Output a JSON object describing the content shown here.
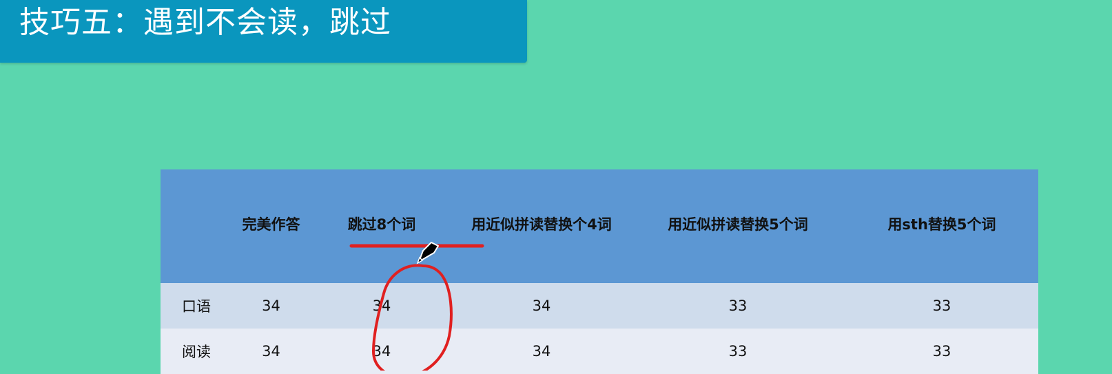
{
  "slide": {
    "title": "技巧五：遇到不会读，跳过"
  },
  "table": {
    "headers": [
      "",
      "完美作答",
      "跳过8个词",
      "用近似拼读替换个4词",
      "用近似拼读替换5个词",
      "用sth替换5个词"
    ],
    "rows": [
      {
        "label": "口语",
        "cells": [
          "34",
          "34",
          "34",
          "33",
          "33"
        ]
      },
      {
        "label": "阅读",
        "cells": [
          "34",
          "34",
          "34",
          "33",
          "33"
        ]
      }
    ]
  },
  "annotations": {
    "ink_color": "#e02020",
    "items": [
      "red-underline",
      "red-circle",
      "pen-cursor-icon"
    ]
  }
}
